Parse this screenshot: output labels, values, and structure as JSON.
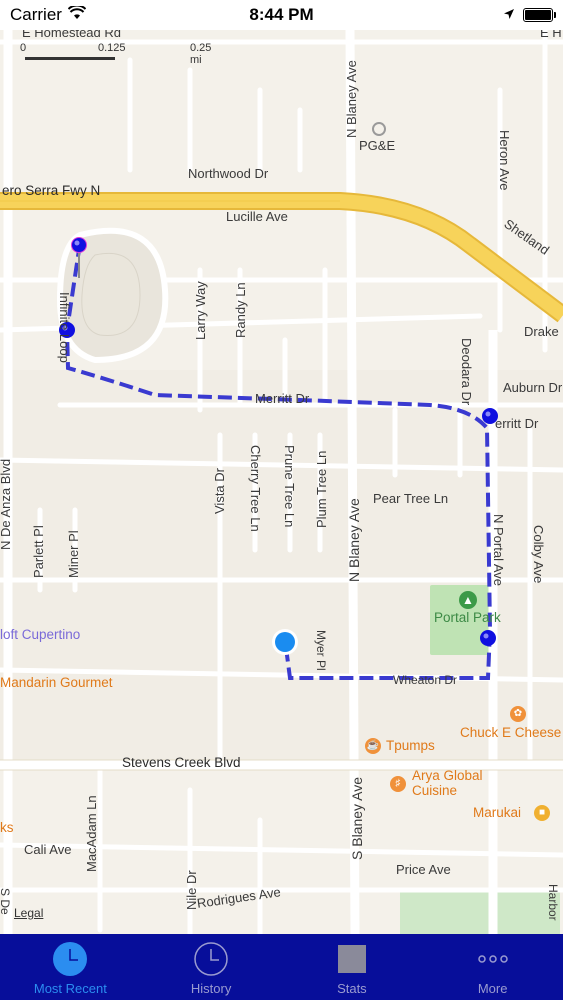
{
  "status_bar": {
    "carrier": "Carrier",
    "time": "8:44 PM"
  },
  "map": {
    "scale": {
      "label_0": "0",
      "label_1": "0.125",
      "label_2": "0.25 mi"
    },
    "legal": "Legal",
    "labels": {
      "homestead": "E Homestead Rd",
      "homestead_e": "E H",
      "blaney_n": "N Blaney Ave",
      "pge": "PG&E",
      "heron": "Heron Ave",
      "shetland": "Shetland",
      "northwood": "Northwood Dr",
      "freeway": "ero Serra Fwy N",
      "lucille": "Lucille Ave",
      "larry": "Larry Way",
      "randy": "Randy Ln",
      "infinite_loop": "Infinite Loop",
      "drake": "Drake",
      "deodara": "Deodara Dr",
      "auburn": "Auburn Dr",
      "merritt": "Merritt Dr",
      "merritt_e": "erritt Dr",
      "de_anza": "N De Anza Blvd",
      "vista": "Vista Dr",
      "cherry": "Cherry Tree Ln",
      "prune": "Prune Tree Ln",
      "plum": "Plum Tree Ln",
      "pear": "Pear Tree Ln",
      "blaney_n2": "N Blaney Ave",
      "portal": "N Portal Ave",
      "colby": "Colby Ave",
      "parlett": "Parlett Pl",
      "miner": "Miner Pl",
      "portal_park": "Portal Park",
      "aloft": "loft Cupertino",
      "myer": "Myer Pl",
      "mandarin": "Mandarin Gourmet",
      "wheaton": "Wheaton Dr",
      "chuck": "Chuck E Cheese",
      "tpumps": "Tpumps",
      "stevens_creek": "Stevens Creek Blvd",
      "arya_1": "Arya Global",
      "arya_2": "Cuisine",
      "marukai": "Marukai",
      "macadam": "MacAdam Ln",
      "blaney_s": "S Blaney Ave",
      "ks": "ks",
      "cali": "Cali Ave",
      "price": "Price Ave",
      "nile": "Nile Dr",
      "rodrigues": "Rodrigues Ave",
      "sde": "S De",
      "harbor": "Harbor"
    },
    "colors": {
      "route": "#3a3ad0",
      "freeway": "#f7d35a",
      "pin": "#1010e0",
      "user_location": "#1a8cf0"
    }
  },
  "tabs": [
    {
      "label": "Most Recent",
      "icon": "clock-filled-icon",
      "active": true
    },
    {
      "label": "History",
      "icon": "clock-outline-icon",
      "active": false
    },
    {
      "label": "Stats",
      "icon": "stats-square-icon",
      "active": false
    },
    {
      "label": "More",
      "icon": "more-dots-icon",
      "active": false
    }
  ]
}
